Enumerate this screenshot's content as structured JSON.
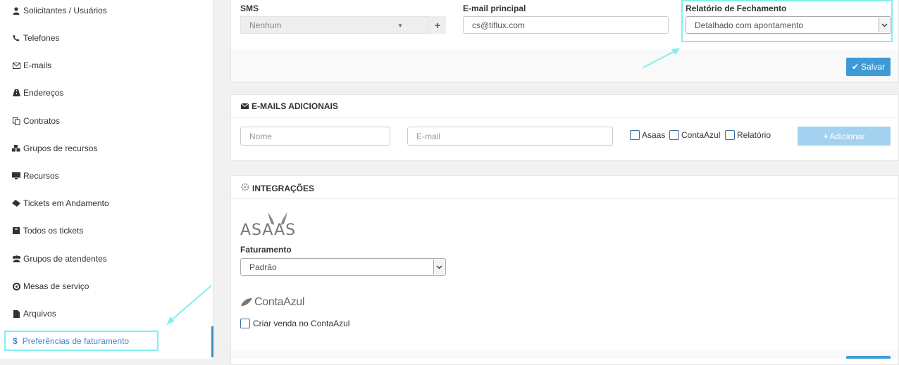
{
  "sidebar": {
    "items": [
      {
        "label": "Solicitantes / Usuários",
        "icon": "user-icon"
      },
      {
        "label": "Telefones",
        "icon": "phone-icon"
      },
      {
        "label": "E-mails",
        "icon": "envelope-icon"
      },
      {
        "label": "Endereços",
        "icon": "road-icon"
      },
      {
        "label": "Contratos",
        "icon": "copy-icon"
      },
      {
        "label": "Grupos de recursos",
        "icon": "cubes-icon"
      },
      {
        "label": "Recursos",
        "icon": "desktop-icon"
      },
      {
        "label": "Tickets em Andamento",
        "icon": "ticket-icon"
      },
      {
        "label": "Todos os tickets",
        "icon": "archive-icon"
      },
      {
        "label": "Grupos de atendentes",
        "icon": "users-icon"
      },
      {
        "label": "Mesas de serviço",
        "icon": "lifebuoy-icon"
      },
      {
        "label": "Arquivos",
        "icon": "file-icon"
      },
      {
        "label": "Preferências de faturamento",
        "icon": "dollar-icon",
        "active": true
      }
    ]
  },
  "form": {
    "sms_label": "SMS",
    "sms_value": "Nenhum",
    "email_label": "E-mail principal",
    "email_value": "cs@tiflux.com",
    "report_label": "Relatório de Fechamento",
    "report_value": "Detalhado com apontamento",
    "save_label": "Salvar"
  },
  "emails": {
    "title": "E-MAILS ADICIONAIS",
    "name_placeholder": "Nome",
    "email_placeholder": "E-mail",
    "check_asaas": "Asaas",
    "check_contaazul": "ContaAzul",
    "check_relatorio": "Relatório",
    "add_label": "Adicionar"
  },
  "integrations": {
    "title": "INTEGRAÇÕES",
    "asaas_logo": "ASAAS",
    "billing_label": "Faturamento",
    "billing_value": "Padrão",
    "contaazul_logo": "ContaAzul",
    "contaazul_check": "Criar venda no ContaAzul"
  },
  "colors": {
    "accent": "#3c9bd6",
    "highlight": "#7ff0ee",
    "active_text": "#3a8ad6"
  }
}
